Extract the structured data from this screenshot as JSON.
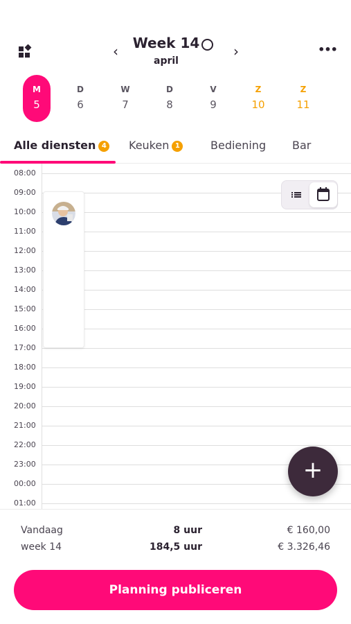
{
  "header": {
    "week_title": "Week 14",
    "month": "april",
    "prev_glyph": "‹",
    "next_glyph": "›",
    "more_glyph": "•••",
    "icons": {
      "menu": "grid-icon",
      "status": "circle-status-icon"
    }
  },
  "days": [
    {
      "letter": "M",
      "number": "5",
      "active": true,
      "weekend": false
    },
    {
      "letter": "D",
      "number": "6",
      "active": false,
      "weekend": false
    },
    {
      "letter": "W",
      "number": "7",
      "active": false,
      "weekend": false
    },
    {
      "letter": "D",
      "number": "8",
      "active": false,
      "weekend": false
    },
    {
      "letter": "V",
      "number": "9",
      "active": false,
      "weekend": false
    },
    {
      "letter": "Z",
      "number": "10",
      "active": false,
      "weekend": true
    },
    {
      "letter": "Z",
      "number": "11",
      "active": false,
      "weekend": true
    }
  ],
  "tabs": [
    {
      "label": "Alle diensten",
      "badge": "4",
      "active": true
    },
    {
      "label": "Keuken",
      "badge": "1",
      "active": false
    },
    {
      "label": "Bediening",
      "badge": null,
      "active": false
    },
    {
      "label": "Bar",
      "badge": null,
      "active": false
    }
  ],
  "schedule": {
    "times": [
      "08:00",
      "09:00",
      "10:00",
      "11:00",
      "12:00",
      "13:00",
      "14:00",
      "15:00",
      "16:00",
      "17:00",
      "18:00",
      "19:00",
      "20:00",
      "21:00",
      "22:00",
      "23:00",
      "00:00",
      "01:00"
    ],
    "view_toggle": {
      "selected": "calendar",
      "options": [
        "list-icon",
        "calendar-icon"
      ]
    }
  },
  "fab": {
    "glyph": "+"
  },
  "summary": {
    "today": {
      "label": "Vandaag",
      "hours": "8 uur",
      "amount": "€ 160,00"
    },
    "week": {
      "label": "week 14",
      "hours": "184,5 uur",
      "amount": "€ 3.326,46"
    }
  },
  "publish": {
    "label": "Planning publiceren"
  },
  "colors": {
    "accent": "#ff0a78",
    "weekend": "#f5a000",
    "badge": "#f5a000",
    "fab": "#3d2a3b",
    "text": "#2b2230"
  }
}
